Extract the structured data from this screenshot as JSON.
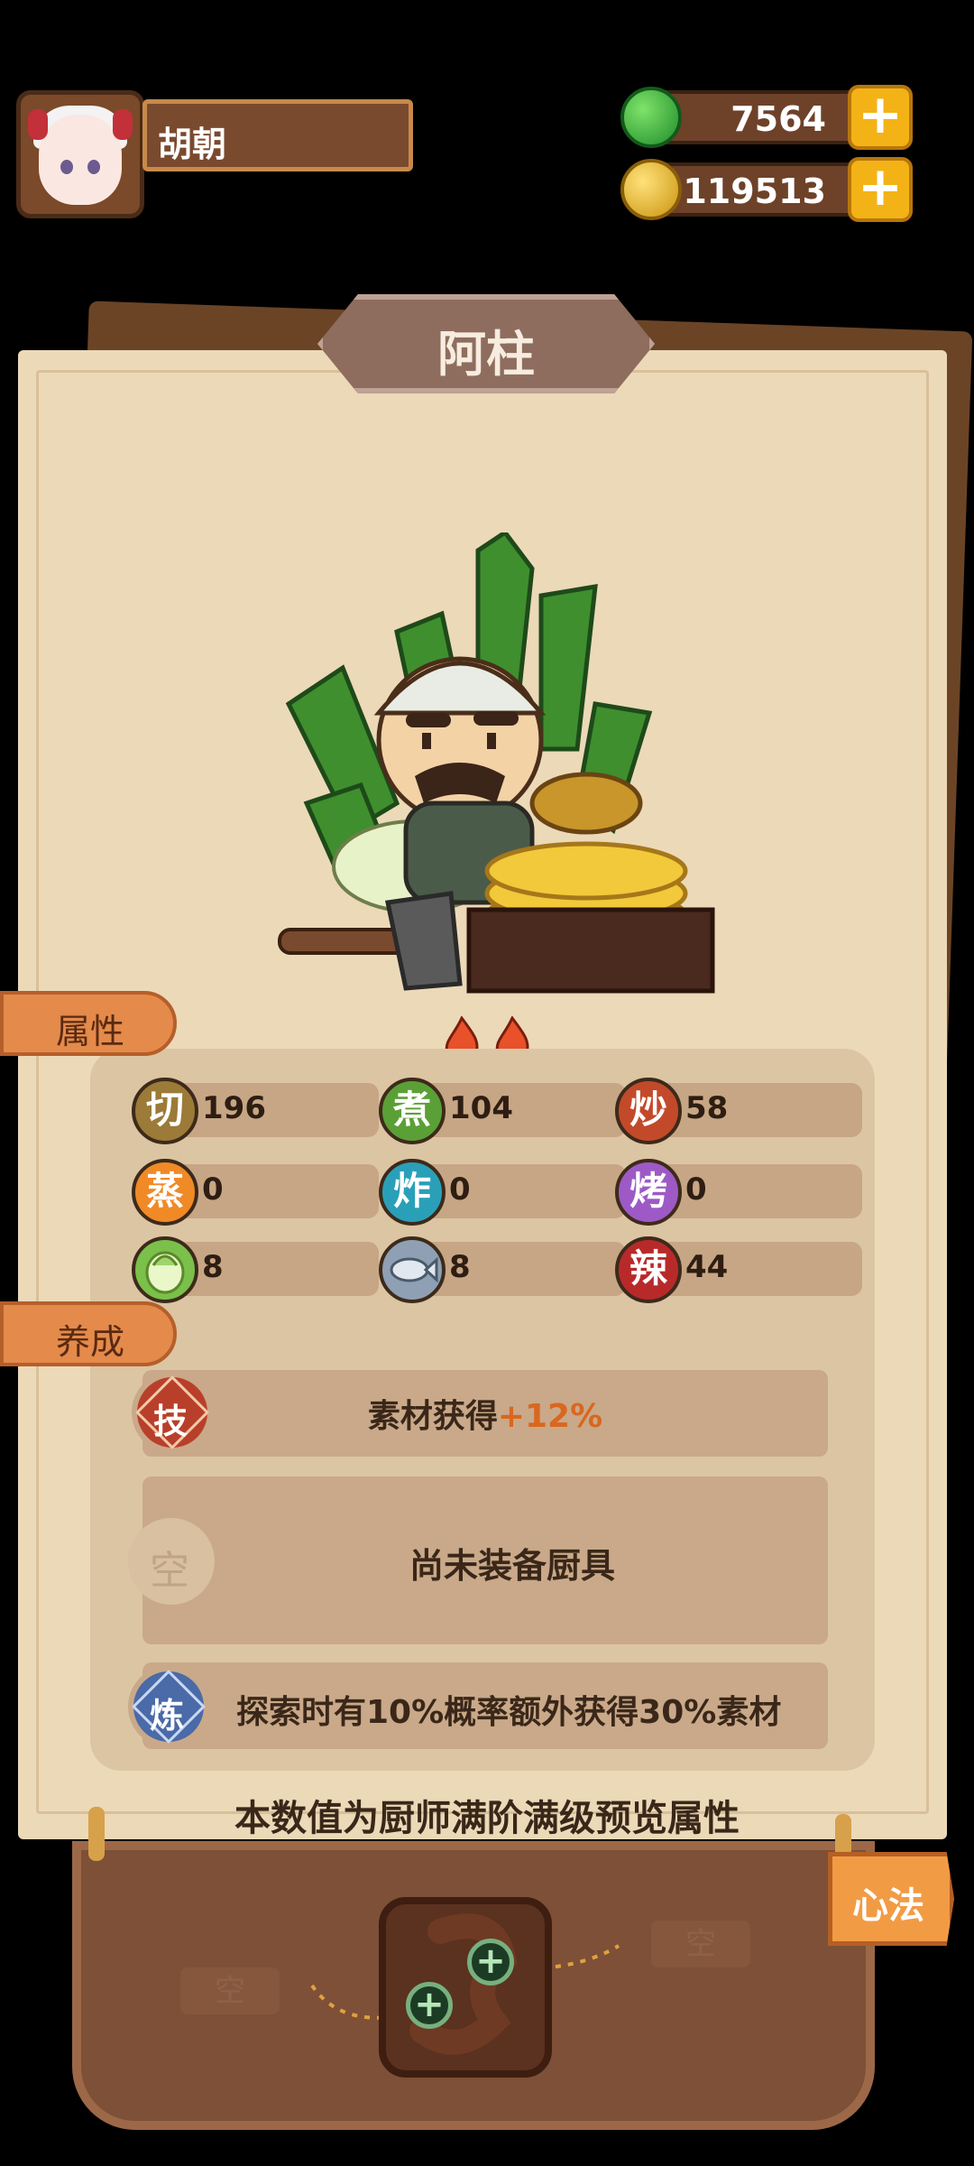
{
  "player": {
    "name": "胡朝"
  },
  "resources": {
    "jade": "7564",
    "coins": "119513",
    "add_symbol": "+"
  },
  "chef": {
    "name": "阿柱",
    "stars": 2
  },
  "tabs": {
    "attributes": "属性",
    "training": "养成"
  },
  "stats": [
    {
      "icon": "切",
      "value": "196",
      "color": "#9c7a38"
    },
    {
      "icon": "煮",
      "value": "104",
      "color": "#5aa036"
    },
    {
      "icon": "炒",
      "value": "58",
      "color": "#c24a2a"
    },
    {
      "icon": "蒸",
      "value": "0",
      "color": "#f08a26"
    },
    {
      "icon": "炸",
      "value": "0",
      "color": "#2aa0b8"
    },
    {
      "icon": "烤",
      "value": "0",
      "color": "#9d5ac6"
    },
    {
      "icon": "cabbage",
      "value": "8",
      "color": "#7ac04a"
    },
    {
      "icon": "fish",
      "value": "8",
      "color": "#8fa0b4"
    },
    {
      "icon": "辣",
      "value": "44",
      "color": "#b82a2a"
    }
  ],
  "training": {
    "skill": {
      "icon": "技",
      "text_prefix": "素材获得",
      "text_bonus": "+12%"
    },
    "equipment": {
      "icon": "空",
      "text": "尚未装备厨具"
    },
    "refine": {
      "icon": "炼",
      "text": "探索时有10%概率额外获得30%素材"
    }
  },
  "note": "本数值为厨师满阶满级预览属性",
  "bottom": {
    "left_empty": "空",
    "right_empty": "空",
    "xinfa_button": "心法"
  },
  "colors": {
    "accent_orange": "#e48a4b",
    "bonus_orange": "#d9671f"
  }
}
